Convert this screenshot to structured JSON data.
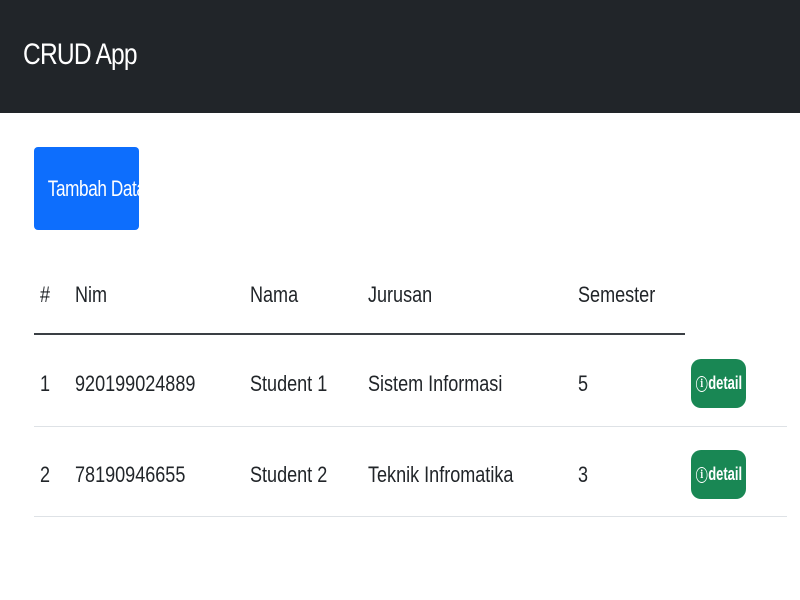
{
  "navbar": {
    "brand": "CRUD App"
  },
  "toolbar": {
    "add_label": "Tambah Data"
  },
  "table": {
    "headers": [
      "#",
      "Nim",
      "Nama",
      "Jurusan",
      "Semester"
    ],
    "rows": [
      {
        "no": "1",
        "nim": "920199024889",
        "nama": "Student 1",
        "jurusan": "Sistem Informasi",
        "semester": "5",
        "action_label": "detail",
        "action_icon": "info-circle-icon"
      },
      {
        "no": "2",
        "nim": "78190946655",
        "nama": "Student 2",
        "jurusan": "Teknik Infromatika",
        "semester": "3",
        "action_label": "detail",
        "action_icon": "info-circle-icon"
      }
    ]
  },
  "colors": {
    "navbar_bg": "#212529",
    "primary": "#0d6efd",
    "success": "#198754"
  }
}
